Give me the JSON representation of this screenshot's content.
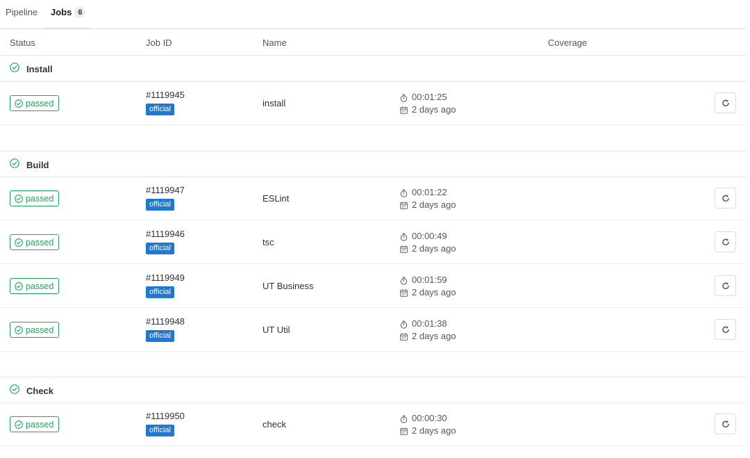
{
  "tabs": {
    "pipeline": "Pipeline",
    "jobs": "Jobs",
    "jobs_count": "6"
  },
  "columns": {
    "status": "Status",
    "job_id": "Job ID",
    "name": "Name",
    "coverage": "Coverage"
  },
  "stages": [
    {
      "name": "Install",
      "jobs": [
        {
          "status": "passed",
          "id": "#1119945",
          "tag": "official",
          "name": "install",
          "duration": "00:01:25",
          "finished": "2 days ago"
        }
      ]
    },
    {
      "name": "Build",
      "jobs": [
        {
          "status": "passed",
          "id": "#1119947",
          "tag": "official",
          "name": "ESLint",
          "duration": "00:01:22",
          "finished": "2 days ago"
        },
        {
          "status": "passed",
          "id": "#1119946",
          "tag": "official",
          "name": "tsc",
          "duration": "00:00:49",
          "finished": "2 days ago"
        },
        {
          "status": "passed",
          "id": "#1119949",
          "tag": "official",
          "name": "UT Business",
          "duration": "00:01:59",
          "finished": "2 days ago"
        },
        {
          "status": "passed",
          "id": "#1119948",
          "tag": "official",
          "name": "UT Util",
          "duration": "00:01:38",
          "finished": "2 days ago"
        }
      ]
    },
    {
      "name": "Check",
      "jobs": [
        {
          "status": "passed",
          "id": "#1119950",
          "tag": "official",
          "name": "check",
          "duration": "00:00:30",
          "finished": "2 days ago"
        }
      ]
    }
  ],
  "colors": {
    "success": "#1aaa55",
    "tag_blue": "#1f78d1",
    "border": "#e5e5e5"
  },
  "icons": {
    "stage": "check-circle-icon",
    "status": "check-circle-icon",
    "duration": "timer-icon",
    "finished": "calendar-icon",
    "retry": "retry-icon"
  }
}
